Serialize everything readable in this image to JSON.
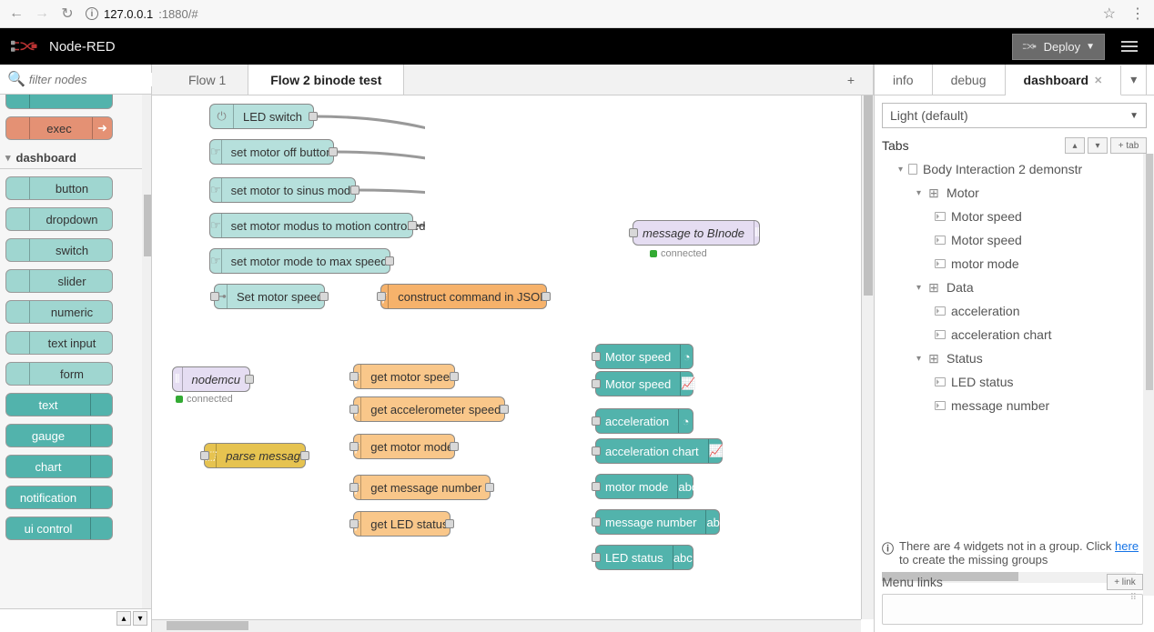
{
  "chrome": {
    "host": "127.0.0.1",
    "port_path": ":1880/#"
  },
  "header": {
    "title": "Node-RED",
    "deploy": "Deploy"
  },
  "palette": {
    "filter_placeholder": "filter nodes",
    "extra_node": "exec",
    "category": "dashboard",
    "nodes": [
      "button",
      "dropdown",
      "switch",
      "slider",
      "numeric",
      "text input",
      "form",
      "text",
      "gauge",
      "chart",
      "notification",
      "ui control"
    ]
  },
  "workspace": {
    "tabs": {
      "t1": "Flow 1",
      "t2": "Flow 2 binode test"
    },
    "nodes": {
      "led_switch": "LED switch",
      "motor_off": "set motor off button",
      "motor_sinus": "set motor to sinus mode",
      "motor_motion": "set motor modus to motion controlled",
      "motor_max": "set motor mode to max speed",
      "set_speed": "Set motor speed",
      "construct_json": "construct command in JSON",
      "msg_binode": "message to BInode",
      "connected": "connected",
      "nodemcu": "nodemcu",
      "parse": "parse message",
      "get_speed": "get motor speed",
      "get_accel": "get accelerometer speed",
      "get_mode": "get motor mode",
      "get_msgnum": "get message number",
      "get_led": "get LED status",
      "o_speed1": "Motor speed",
      "o_speed2": "Motor speed",
      "o_accel": "acceleration",
      "o_accel_chart": "acceleration chart",
      "o_mode": "motor mode",
      "o_msgnum": "message number",
      "o_led": "LED status"
    }
  },
  "sidebar": {
    "tabs": {
      "info": "info",
      "debug": "debug",
      "dashboard": "dashboard"
    },
    "theme": "Light (default)",
    "tabs_label": "Tabs",
    "add_tab": "+ tab",
    "tree": {
      "root": "Body Interaction 2 demonstr",
      "grp_motor": "Motor",
      "motor_speed1": "Motor speed",
      "motor_speed2": "Motor speed",
      "motor_mode": "motor mode",
      "grp_data": "Data",
      "accel": "acceleration",
      "accel_chart": "acceleration chart",
      "grp_status": "Status",
      "led": "LED status",
      "msgnum": "message number"
    },
    "alert_pre": "There are 4 widgets not in a group. Click ",
    "alert_link": "here",
    "alert_post": " to create the missing groups",
    "menu_links": "Menu links",
    "add_link": "+ link"
  }
}
